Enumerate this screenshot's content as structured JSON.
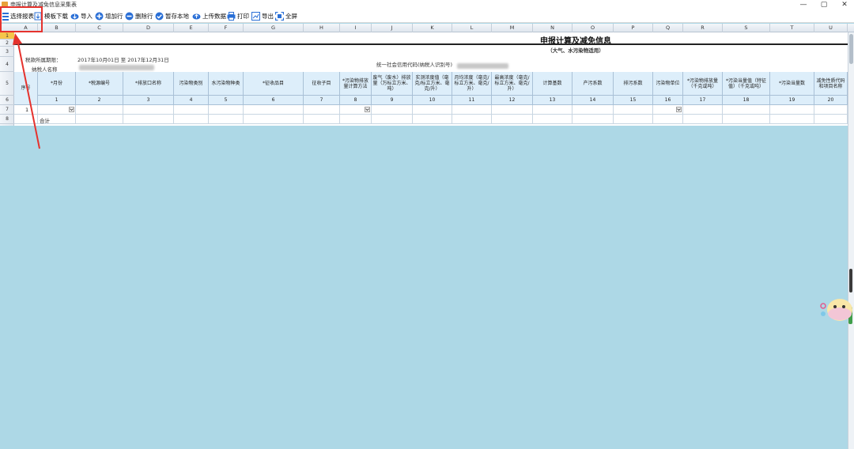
{
  "window": {
    "title": "申报计算及减免信息采集表",
    "controls": {
      "minimize": "—",
      "maximize": "▢",
      "close": "✕"
    }
  },
  "toolbar": [
    {
      "name": "select-report-button",
      "label": "选择报表",
      "icon": "list-icon",
      "color": "#2a6fd6"
    },
    {
      "name": "template-download-button",
      "label": "模板下载",
      "icon": "download-icon",
      "color": "#2a6fd6"
    },
    {
      "name": "import-button",
      "label": "导入",
      "icon": "cloud-import-icon",
      "color": "#2a6fd6"
    },
    {
      "name": "add-row-button",
      "label": "增加行",
      "icon": "plus-circle-icon",
      "color": "#2a6fd6"
    },
    {
      "name": "delete-row-button",
      "label": "删除行",
      "icon": "minus-circle-icon",
      "color": "#2a6fd6"
    },
    {
      "name": "save-local-button",
      "label": "暂存本地",
      "icon": "check-circle-icon",
      "color": "#2a6fd6"
    },
    {
      "name": "upload-data-button",
      "label": "上传数据",
      "icon": "cloud-upload-icon",
      "color": "#2a6fd6"
    },
    {
      "name": "print-button",
      "label": "打印",
      "icon": "printer-icon",
      "color": "#2a6fd6"
    },
    {
      "name": "export-button",
      "label": "导出",
      "icon": "export-icon",
      "color": "#2a6fd6"
    },
    {
      "name": "fullscreen-button",
      "label": "全屏",
      "icon": "fullscreen-icon",
      "color": "#2a6fd6"
    }
  ],
  "columns": [
    "A",
    "B",
    "C",
    "D",
    "E",
    "F",
    "G",
    "H",
    "I",
    "J",
    "K",
    "L",
    "M",
    "N",
    "O",
    "P",
    "Q",
    "R",
    "S",
    "T",
    "U"
  ],
  "rows": [
    "1",
    "2",
    "3",
    "4",
    "5",
    "6",
    "7",
    "8"
  ],
  "sheet": {
    "title": "申报计算及减免信息",
    "subtitle": "（大气、水污染物适用）",
    "period_label": "税款所属期限：",
    "period_value": "2017年10月01日 至 2017年12月31日",
    "taxpayer_label": "纳税人名称",
    "credit_code_label": "统一社会信用代码(纳税人识别号)"
  },
  "headers": [
    "序号",
    "*月份",
    "*税源编号",
    "*排放口名称",
    "污染物类别",
    "水污染物种类",
    "*征收品目",
    "征收子目",
    "*污染物排放量计算方法",
    "废气（废水）排放量（万标立方米、吨）",
    "实测浓度值（毫克/标立方米、毫克/升）",
    "月均浓度（毫克/标立方米、毫克/升）",
    "最高浓度（毫克/标立方米、毫克/升）",
    "计算基数",
    "产污系数",
    "排污系数",
    "污染物单位",
    "*污染物排放量（千克或吨）",
    "*污染当量值（特征值）（千克或吨）",
    "*污染当量数",
    "减免性质代码和项目名称"
  ],
  "header_numbers": [
    "",
    "1",
    "2",
    "3",
    "4",
    "5",
    "6",
    "7",
    "8",
    "9",
    "10",
    "11",
    "12",
    "13",
    "14",
    "15",
    "16",
    "17",
    "18",
    "19",
    "20"
  ],
  "data_rows": {
    "row7_index": "1",
    "row8_label": "合计"
  }
}
